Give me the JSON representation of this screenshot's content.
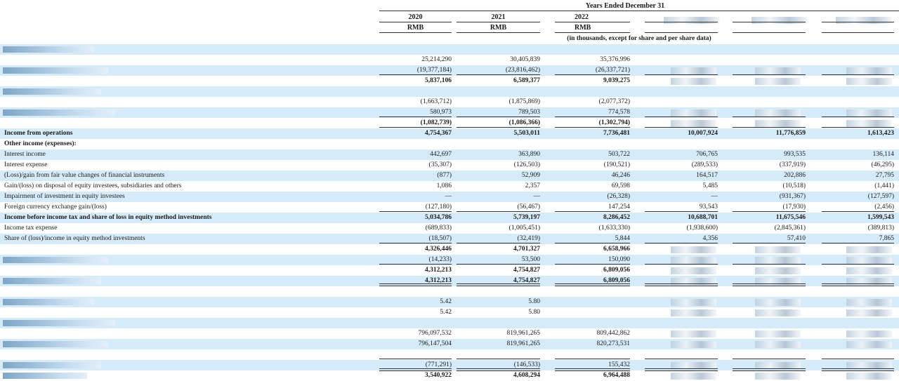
{
  "header": {
    "years_ended": "Years Ended December 31",
    "columns": [
      {
        "year": "2020",
        "currency": "RMB"
      },
      {
        "year": "2021",
        "currency": "RMB"
      },
      {
        "year": "2022",
        "currency": "RMB"
      }
    ],
    "units_note": "(in thousands, except for share and per share data)"
  },
  "rows": [
    {
      "label": "",
      "values": [
        "",
        "",
        "",
        "",
        "",
        ""
      ],
      "band": true
    },
    {
      "label": "",
      "values": [
        "25,214,290",
        "30,405,839",
        "35,376,996",
        "",
        "",
        ""
      ],
      "band": false
    },
    {
      "label": "",
      "values": [
        "(19,377,184)",
        "(23,816,462)",
        "(26,337,721)",
        "",
        "",
        ""
      ],
      "band": true
    },
    {
      "label": "",
      "values": [
        "5,837,106",
        "6,589,377",
        "9,039,275",
        "",
        "",
        ""
      ],
      "band": false,
      "bold": true
    },
    {
      "label": "",
      "values": [
        "",
        "",
        "",
        "",
        "",
        ""
      ],
      "band": true
    },
    {
      "label": "",
      "values": [
        "(1,663,712)",
        "(1,875,869)",
        "(2,077,372)",
        "",
        "",
        ""
      ],
      "band": false
    },
    {
      "label": "",
      "values": [
        "580,973",
        "789,503",
        "774,578",
        "",
        "",
        ""
      ],
      "band": true
    },
    {
      "label": "",
      "values": [
        "(1,082,739)",
        "(1,086,366)",
        "(1,302,794)",
        "",
        "",
        ""
      ],
      "band": false,
      "bold": true
    },
    {
      "label": "Income from operations",
      "values": [
        "4,754,367",
        "5,503,011",
        "7,736,481",
        "10,007,924",
        "11,776,859",
        "1,613,423"
      ],
      "band": true,
      "bold": true
    },
    {
      "label": "Other income (expenses):",
      "values": [
        "",
        "",
        "",
        "",
        "",
        ""
      ],
      "band": false,
      "bold": true
    },
    {
      "label": "Interest income",
      "values": [
        "442,697",
        "363,890",
        "503,722",
        "706,765",
        "993,535",
        "136,114"
      ],
      "band": true
    },
    {
      "label": "Interest expense",
      "values": [
        "(35,307)",
        "(126,503)",
        "(190,521)",
        "(289,533)",
        "(337,919)",
        "(46,295)"
      ],
      "band": false
    },
    {
      "label": "(Loss)/gain from fair value changes of financial instruments",
      "values": [
        "(877)",
        "52,909",
        "46,246",
        "164,517",
        "202,886",
        "27,795"
      ],
      "band": true
    },
    {
      "label": "Gain/(loss) on disposal of equity investees, subsidiaries and others",
      "values": [
        "1,086",
        "2,357",
        "69,598",
        "5,485",
        "(10,518)",
        "(1,441)"
      ],
      "band": false
    },
    {
      "label": "Impairment of investment in equity investees",
      "values": [
        "—",
        "—",
        "(26,328)",
        "—",
        "(931,367)",
        "(127,597)"
      ],
      "band": true
    },
    {
      "label": "Foreign currency exchange gain/(loss)",
      "values": [
        "(127,180)",
        "(56,467)",
        "147,254",
        "93,543",
        "(17,930)",
        "(2,456)"
      ],
      "band": false
    },
    {
      "label": "Income before income tax and share of loss in equity method investments",
      "values": [
        "5,034,786",
        "5,739,197",
        "8,286,452",
        "10,688,701",
        "11,675,546",
        "1,599,543"
      ],
      "band": true,
      "bold": true
    },
    {
      "label": "Income tax expense",
      "values": [
        "(689,833)",
        "(1,005,451)",
        "(1,633,330)",
        "(1,938,600)",
        "(2,845,361)",
        "(389,813)"
      ],
      "band": false
    },
    {
      "label": "Share of (loss)/income in equity method investments",
      "values": [
        "(18,507)",
        "(32,419)",
        "5,844",
        "4,356",
        "57,410",
        "7,865"
      ],
      "band": true
    },
    {
      "label": "",
      "values": [
        "4,326,446",
        "4,701,327",
        "6,658,966",
        "",
        "",
        ""
      ],
      "band": false,
      "bold": true
    },
    {
      "label": "",
      "values": [
        "(14,233)",
        "53,500",
        "150,090",
        "",
        "",
        ""
      ],
      "band": true
    },
    {
      "label": "",
      "values": [
        "4,312,213",
        "4,754,827",
        "6,809,056",
        "",
        "",
        ""
      ],
      "band": false,
      "bold": true
    },
    {
      "label": "",
      "values": [
        "4,312,213",
        "4,754,827",
        "6,809,056",
        "",
        "",
        ""
      ],
      "band": true,
      "bold": true
    },
    {
      "label": "",
      "values": [
        "",
        "",
        "",
        "",
        "",
        ""
      ],
      "band": false
    },
    {
      "label": "",
      "values": [
        "5.42",
        "5.80",
        "",
        "",
        "",
        ""
      ],
      "band": true
    },
    {
      "label": "",
      "values": [
        "5.42",
        "5.80",
        "",
        "",
        "",
        ""
      ],
      "band": false
    },
    {
      "label": "",
      "values": [
        "",
        "",
        "",
        "",
        "",
        ""
      ],
      "band": true
    },
    {
      "label": "",
      "values": [
        "796,097,532",
        "819,961,265",
        "809,442,862",
        "",
        "",
        ""
      ],
      "band": false
    },
    {
      "label": "",
      "values": [
        "796,147,504",
        "819,961,265",
        "820,273,531",
        "",
        "",
        ""
      ],
      "band": true
    },
    {
      "label": "",
      "values": [
        "",
        "",
        "",
        "",
        "",
        ""
      ],
      "band": false
    },
    {
      "label": "",
      "values": [
        "(771,291)",
        "(146,533)",
        "155,432",
        "",
        "",
        ""
      ],
      "band": true
    },
    {
      "label": "",
      "values": [
        "3,540,922",
        "4,608,294",
        "6,964,488",
        "",
        "",
        ""
      ],
      "band": false,
      "bold": true
    }
  ]
}
